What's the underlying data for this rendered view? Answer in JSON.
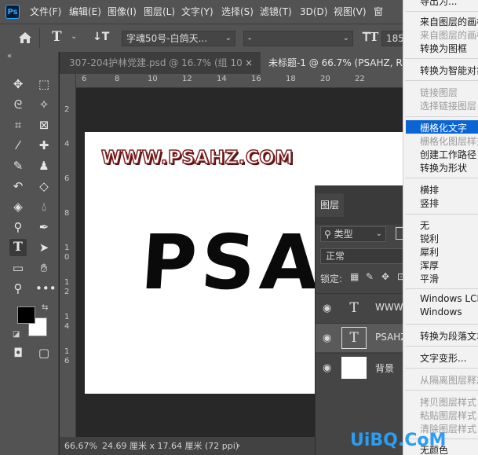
{
  "app": {
    "logo": "Ps"
  },
  "menubar": {
    "items": [
      "文件(F)",
      "编辑(E)",
      "图像(I)",
      "图层(L)",
      "文字(Y)",
      "选择(S)",
      "滤镜(T)",
      "3D(D)",
      "视图(V)",
      "窗"
    ]
  },
  "options": {
    "font_family": "字魂50号-白鸽天...",
    "font_style": "-",
    "font_size": "185",
    "home_icon": "home-icon",
    "text_icon": "T",
    "vertical_text_icon": "↓T"
  },
  "tabs": [
    {
      "label": "307-204护林党建.psd @ 16.7% (组 10,...",
      "close": "×"
    },
    {
      "label": "未标题-1 @ 66.7% (PSAHZ, RGB",
      "close": ""
    }
  ],
  "ruler_top": [
    "6",
    "8",
    "10",
    "12",
    "14",
    "16",
    "18",
    "20",
    "22"
  ],
  "ruler_left": [
    "2",
    "4",
    "6",
    "8",
    "1",
    "0",
    "1",
    "2",
    "1",
    "4",
    "1",
    "6"
  ],
  "canvas": {
    "www": "WWW.PSAHZ.COM",
    "big": "PSAH"
  },
  "status": {
    "zoom": "66.67%",
    "doc_info": "24.69 厘米 x 17.64 厘米 (72 ppi)"
  },
  "layers_panel": {
    "title": "图层",
    "filter_label": "类型",
    "blend_mode": "正常",
    "lock_label": "锁定:",
    "layers": [
      {
        "name": "WWW.P",
        "thumb": "T"
      },
      {
        "name": "PSAHZ",
        "thumb": "T"
      },
      {
        "name": "背景",
        "thumb": ""
      }
    ]
  },
  "context_menu": {
    "top_partial": "导出为...",
    "items": [
      {
        "label": "来自图层的画板",
        "disabled": false
      },
      {
        "label": "来自图层的画框",
        "disabled": true
      },
      {
        "label": "转换为图框",
        "disabled": false
      },
      {
        "label": "转换为智能对象",
        "disabled": false
      },
      {
        "label": "链接图层",
        "disabled": true
      },
      {
        "label": "选择链接图层",
        "disabled": true
      },
      {
        "label": "栅格化文字",
        "disabled": false,
        "highlighted": true
      },
      {
        "label": "栅格化图层样式",
        "disabled": true
      },
      {
        "label": "创建工作路径",
        "disabled": false
      },
      {
        "label": "转换为形状",
        "disabled": false
      },
      {
        "label": "横排",
        "disabled": false
      },
      {
        "label": "竖排",
        "disabled": false
      },
      {
        "label": "无",
        "disabled": false
      },
      {
        "label": "锐利",
        "disabled": false
      },
      {
        "label": "犀利",
        "disabled": false
      },
      {
        "label": "浑厚",
        "disabled": false
      },
      {
        "label": "平滑",
        "disabled": false
      },
      {
        "label": "Windows LCD",
        "disabled": false
      },
      {
        "label": "Windows",
        "disabled": false
      },
      {
        "label": "转换为段落文本",
        "disabled": false
      },
      {
        "label": "文字变形...",
        "disabled": false
      },
      {
        "label": "从隔离图层释放",
        "disabled": true
      },
      {
        "label": "拷贝图层样式",
        "disabled": true
      },
      {
        "label": "粘贴图层样式",
        "disabled": true
      },
      {
        "label": "清除图层样式",
        "disabled": true
      },
      {
        "label": "无颜色",
        "disabled": false
      }
    ]
  },
  "watermark": "UiBQ.CoM",
  "colors": {
    "accent": "#0a64d2",
    "foreground": "#000000",
    "background": "#ffffff",
    "ps_blue": "#31a8ff"
  }
}
